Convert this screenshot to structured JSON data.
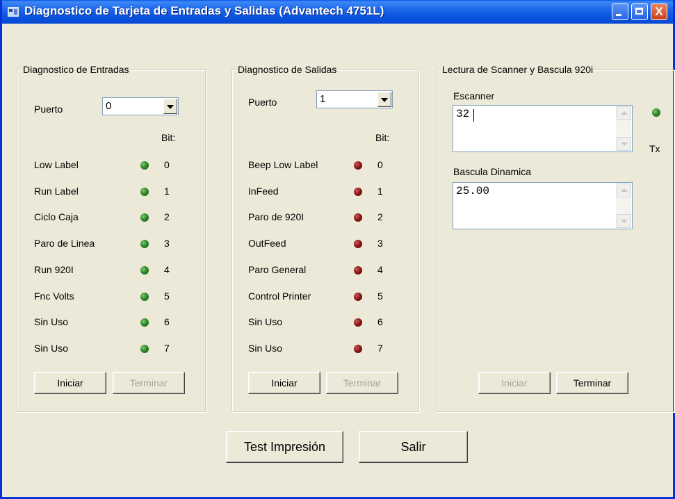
{
  "window": {
    "title": "Diagnostico de Tarjeta de Entradas y Salidas (Advantech 4751L)",
    "close_glyph": "X"
  },
  "entradas": {
    "title": "Diagnostico de Entradas",
    "puerto_label": "Puerto",
    "puerto_value": "0",
    "bit_header": "Bit:",
    "rows": [
      {
        "label": "Low Label",
        "bit": "0"
      },
      {
        "label": "Run Label",
        "bit": "1"
      },
      {
        "label": "Ciclo Caja",
        "bit": "2"
      },
      {
        "label": "Paro de Linea",
        "bit": "3"
      },
      {
        "label": "Run 920I",
        "bit": "4"
      },
      {
        "label": "Fnc Volts",
        "bit": "5"
      },
      {
        "label": "Sin Uso",
        "bit": "6"
      },
      {
        "label": "Sin Uso",
        "bit": "7"
      }
    ],
    "iniciar": "Iniciar",
    "terminar": "Terminar"
  },
  "salidas": {
    "title": "Diagnostico de Salidas",
    "puerto_label": "Puerto",
    "puerto_value": "1",
    "bit_header": "Bit:",
    "rows": [
      {
        "label": "Beep Low Label",
        "bit": "0"
      },
      {
        "label": "InFeed",
        "bit": "1"
      },
      {
        "label": "Paro de 920I",
        "bit": "2"
      },
      {
        "label": "OutFeed",
        "bit": "3"
      },
      {
        "label": "Paro General",
        "bit": "4"
      },
      {
        "label": "Control Printer",
        "bit": "5"
      },
      {
        "label": "Sin Uso",
        "bit": "6"
      },
      {
        "label": "Sin Uso",
        "bit": "7"
      }
    ],
    "iniciar": "Iniciar",
    "terminar": "Terminar"
  },
  "lectura": {
    "title": "Lectura de Scanner y Bascula 920i",
    "escanner_label": "Escanner",
    "escanner_value": "32",
    "tx_label": "Tx",
    "bascula_label": "Bascula Dinamica",
    "bascula_value": "25.00",
    "iniciar": "Iniciar",
    "terminar": "Terminar"
  },
  "footer": {
    "test": "Test Impresión",
    "salir": "Salir"
  },
  "colors": {
    "input_led": "#2f8a2a",
    "output_led": "#8a1414",
    "titlebar": "#0b55e0"
  }
}
